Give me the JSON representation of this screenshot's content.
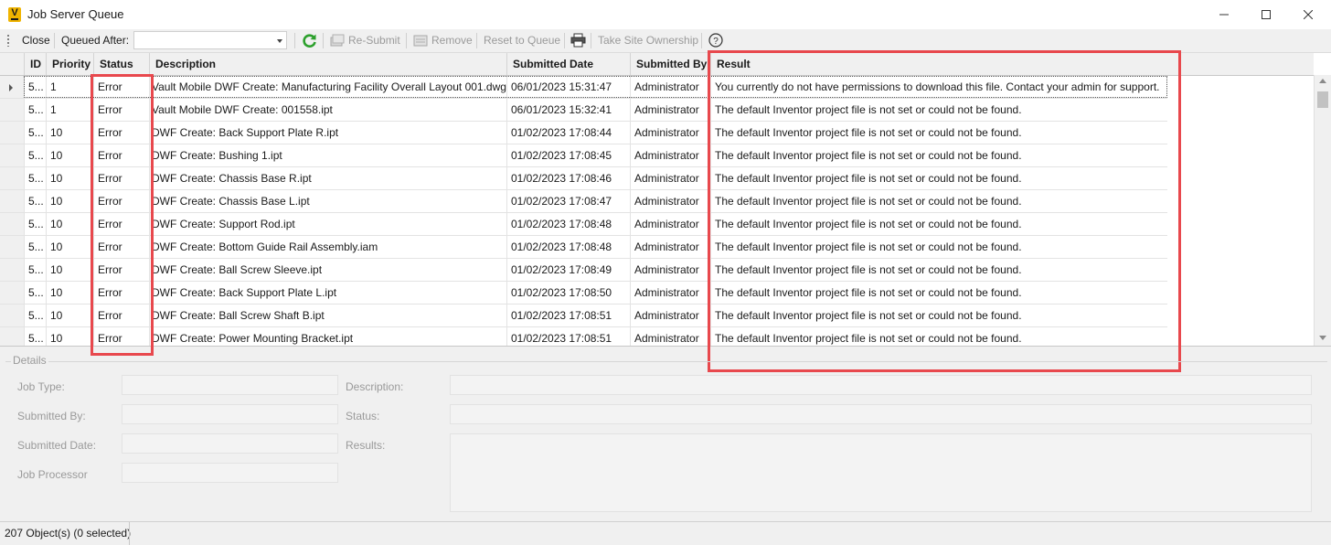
{
  "window": {
    "title": "Job Server Queue",
    "app_icon_letter": "V"
  },
  "toolbar": {
    "close_label": "Close",
    "queued_after_label": "Queued After:",
    "queued_after_value": "",
    "resubmit_label": "Re-Submit",
    "remove_label": "Remove",
    "reset_label": "Reset to Queue",
    "take_ownership_label": "Take Site Ownership"
  },
  "grid": {
    "columns": [
      "ID",
      "Priority",
      "Status",
      "Description",
      "Submitted Date",
      "Submitted By",
      "Result"
    ],
    "rows": [
      {
        "id": "5...",
        "priority": "1",
        "status": "Error",
        "description": "Vault Mobile DWF Create: Manufacturing Facility Overall Layout 001.dwg",
        "date": "06/01/2023 15:31:47",
        "by": "Administrator",
        "result": "You currently do not have permissions to download this file. Contact your admin for support."
      },
      {
        "id": "5...",
        "priority": "1",
        "status": "Error",
        "description": "Vault Mobile DWF Create: 001558.ipt",
        "date": "06/01/2023 15:32:41",
        "by": "Administrator",
        "result": "The default Inventor project file is not set or could not be found."
      },
      {
        "id": "5...",
        "priority": "10",
        "status": "Error",
        "description": "DWF Create: Back Support Plate R.ipt",
        "date": "01/02/2023 17:08:44",
        "by": "Administrator",
        "result": "The default Inventor project file is not set or could not be found."
      },
      {
        "id": "5...",
        "priority": "10",
        "status": "Error",
        "description": "DWF Create: Bushing 1.ipt",
        "date": "01/02/2023 17:08:45",
        "by": "Administrator",
        "result": "The default Inventor project file is not set or could not be found."
      },
      {
        "id": "5...",
        "priority": "10",
        "status": "Error",
        "description": "DWF Create: Chassis Base R.ipt",
        "date": "01/02/2023 17:08:46",
        "by": "Administrator",
        "result": "The default Inventor project file is not set or could not be found."
      },
      {
        "id": "5...",
        "priority": "10",
        "status": "Error",
        "description": "DWF Create: Chassis Base L.ipt",
        "date": "01/02/2023 17:08:47",
        "by": "Administrator",
        "result": "The default Inventor project file is not set or could not be found."
      },
      {
        "id": "5...",
        "priority": "10",
        "status": "Error",
        "description": "DWF Create: Support Rod.ipt",
        "date": "01/02/2023 17:08:48",
        "by": "Administrator",
        "result": "The default Inventor project file is not set or could not be found."
      },
      {
        "id": "5...",
        "priority": "10",
        "status": "Error",
        "description": "DWF Create: Bottom Guide Rail Assembly.iam",
        "date": "01/02/2023 17:08:48",
        "by": "Administrator",
        "result": "The default Inventor project file is not set or could not be found."
      },
      {
        "id": "5...",
        "priority": "10",
        "status": "Error",
        "description": "DWF Create: Ball Screw Sleeve.ipt",
        "date": "01/02/2023 17:08:49",
        "by": "Administrator",
        "result": "The default Inventor project file is not set or could not be found."
      },
      {
        "id": "5...",
        "priority": "10",
        "status": "Error",
        "description": "DWF Create: Back Support Plate L.ipt",
        "date": "01/02/2023 17:08:50",
        "by": "Administrator",
        "result": "The default Inventor project file is not set or could not be found."
      },
      {
        "id": "5...",
        "priority": "10",
        "status": "Error",
        "description": "DWF Create: Ball Screw Shaft B.ipt",
        "date": "01/02/2023 17:08:51",
        "by": "Administrator",
        "result": "The default Inventor project file is not set or could not be found."
      },
      {
        "id": "5...",
        "priority": "10",
        "status": "Error",
        "description": "DWF Create: Power Mounting Bracket.ipt",
        "date": "01/02/2023 17:08:51",
        "by": "Administrator",
        "result": "The default Inventor project file is not set or could not be found."
      }
    ]
  },
  "details": {
    "legend": "Details",
    "job_type_label": "Job Type:",
    "submitted_by_label": "Submitted By:",
    "submitted_date_label": "Submitted Date:",
    "job_processor_label": "Job Processor",
    "description_label": "Description:",
    "status_label": "Status:",
    "results_label": "Results:",
    "job_type_value": "",
    "submitted_by_value": "",
    "submitted_date_value": "",
    "job_processor_value": "",
    "description_value": "",
    "status_value": "",
    "results_value": ""
  },
  "statusbar": {
    "text": "207 Object(s) (0 selected)"
  },
  "colors": {
    "highlight": "#e8484d",
    "refresh_icon": "#2ca02c",
    "app_icon": "#f0b400"
  }
}
